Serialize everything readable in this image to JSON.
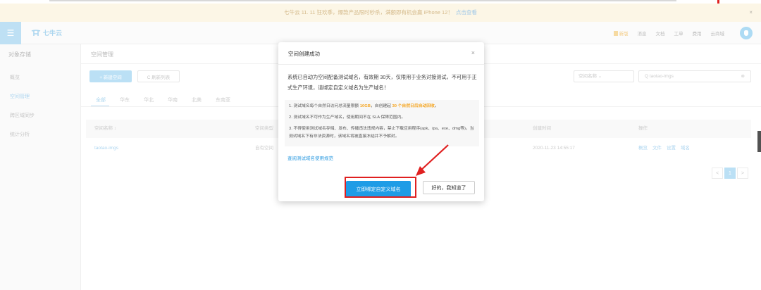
{
  "notice": {
    "text": "七牛云 11. 11 狂欢季，爆款产品限时秒杀，满额即有机会赢 iPhone 12！",
    "link": "点击查看",
    "close": "×"
  },
  "header": {
    "logo_text": "七牛云",
    "nav": [
      "消息",
      "文档",
      "工单",
      "费用",
      "云商城"
    ],
    "highlight": "新版"
  },
  "sidebar": {
    "title": "对象存储",
    "items": [
      "概览",
      "空间管理",
      "跨区域同步",
      "统计分析"
    ]
  },
  "main": {
    "title": "空间管理",
    "new_button": "+ 新建空间",
    "refresh_button": "C 刷新列表",
    "filter_label": "空间名称 ⌄",
    "search_value": "Q taotao-imgs",
    "search_clear": "⊗",
    "tabs": [
      "全部",
      "华东",
      "华北",
      "华南",
      "北美",
      "东南亚"
    ],
    "table_headers": [
      "空间名称 ↕",
      "空间类型",
      "创建时间",
      "操作"
    ],
    "row": {
      "name": "taotao-imgs",
      "type": "自有空间",
      "created": "2020-11-23 14:55:17",
      "actions": [
        "概览",
        "文件",
        "设置",
        "域名"
      ]
    },
    "pager": [
      "<",
      "1",
      ">"
    ]
  },
  "modal": {
    "title": "空间创建成功",
    "close": "×",
    "lead": "系统已自动为空间配备测试域名，有效期 30天，仅限用于业务对接测试，不可用于正式生产环境，请绑定自定义域名为生产域名！",
    "note1_a": "1. 测试域名每个自然日访问总流量限额 ",
    "note1_b": "10GB",
    "note1_c": "，自创建起 ",
    "note1_d": "30 个自然日后自动回收",
    "note1_e": "。",
    "note2": "2. 测试域名不可作为生产域名，使用期间不在 SLA 保障范围内。",
    "note3": "3. 不得使用测试域名存储、发布、传播违法违规内容，禁止下载应用程序(apk、ipa、exe、dmg等)，当测试域名下有非法资源时，该域名将被直接冻结并不予解封。",
    "link": "查阅测试域名使用规范",
    "primary": "立即绑定自定义域名",
    "secondary": "好的，我知道了"
  },
  "colors": {
    "primary": "#1e9ce6",
    "annotation": "#e02020",
    "warning": "#f5a623"
  }
}
